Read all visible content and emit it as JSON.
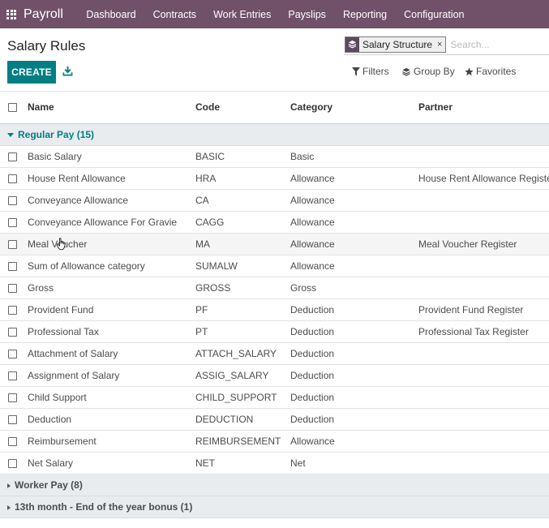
{
  "navbar": {
    "app_name": "Payroll",
    "menu": [
      "Dashboard",
      "Contracts",
      "Work Entries",
      "Payslips",
      "Reporting",
      "Configuration"
    ]
  },
  "page": {
    "title": "Salary Rules"
  },
  "search": {
    "facet_label": "Salary Structure",
    "facet_remove": "×",
    "placeholder": "Search..."
  },
  "toolbar": {
    "create_label": "CREATE",
    "filters_label": "Filters",
    "group_by_label": "Group By",
    "favorites_label": "Favorites"
  },
  "table": {
    "columns": {
      "name": "Name",
      "code": "Code",
      "category": "Category",
      "partner": "Partner"
    },
    "groups": [
      {
        "label": "Regular Pay (15)",
        "expanded": true,
        "rows": [
          {
            "name": "Basic Salary",
            "code": "BASIC",
            "category": "Basic",
            "partner": ""
          },
          {
            "name": "House Rent Allowance",
            "code": "HRA",
            "category": "Allowance",
            "partner": "House Rent Allowance Register"
          },
          {
            "name": "Conveyance Allowance",
            "code": "CA",
            "category": "Allowance",
            "partner": ""
          },
          {
            "name": "Conveyance Allowance For Gravie",
            "code": "CAGG",
            "category": "Allowance",
            "partner": ""
          },
          {
            "name": "Meal Voucher",
            "code": "MA",
            "category": "Allowance",
            "partner": "Meal Voucher Register"
          },
          {
            "name": "Sum of Allowance category",
            "code": "SUMALW",
            "category": "Allowance",
            "partner": ""
          },
          {
            "name": "Gross",
            "code": "GROSS",
            "category": "Gross",
            "partner": ""
          },
          {
            "name": "Provident Fund",
            "code": "PF",
            "category": "Deduction",
            "partner": "Provident Fund Register"
          },
          {
            "name": "Professional Tax",
            "code": "PT",
            "category": "Deduction",
            "partner": "Professional Tax Register"
          },
          {
            "name": "Attachment of Salary",
            "code": "ATTACH_SALARY",
            "category": "Deduction",
            "partner": ""
          },
          {
            "name": "Assignment of Salary",
            "code": "ASSIG_SALARY",
            "category": "Deduction",
            "partner": ""
          },
          {
            "name": "Child Support",
            "code": "CHILD_SUPPORT",
            "category": "Deduction",
            "partner": ""
          },
          {
            "name": "Deduction",
            "code": "DEDUCTION",
            "category": "Deduction",
            "partner": ""
          },
          {
            "name": "Reimbursement",
            "code": "REIMBURSEMENT",
            "category": "Allowance",
            "partner": ""
          },
          {
            "name": "Net Salary",
            "code": "NET",
            "category": "Net",
            "partner": ""
          }
        ]
      },
      {
        "label": "Worker Pay (8)",
        "expanded": false,
        "rows": []
      },
      {
        "label": "13th month - End of the year bonus (1)",
        "expanded": false,
        "rows": []
      }
    ]
  },
  "colors": {
    "navbar": "#71506a",
    "primary": "#017e84",
    "group_bg": "#e9ecef"
  },
  "icons": [
    "apps-grid-icon",
    "layers-icon",
    "download-icon",
    "filter-icon",
    "layers-icon",
    "star-icon",
    "hand-cursor-icon"
  ]
}
